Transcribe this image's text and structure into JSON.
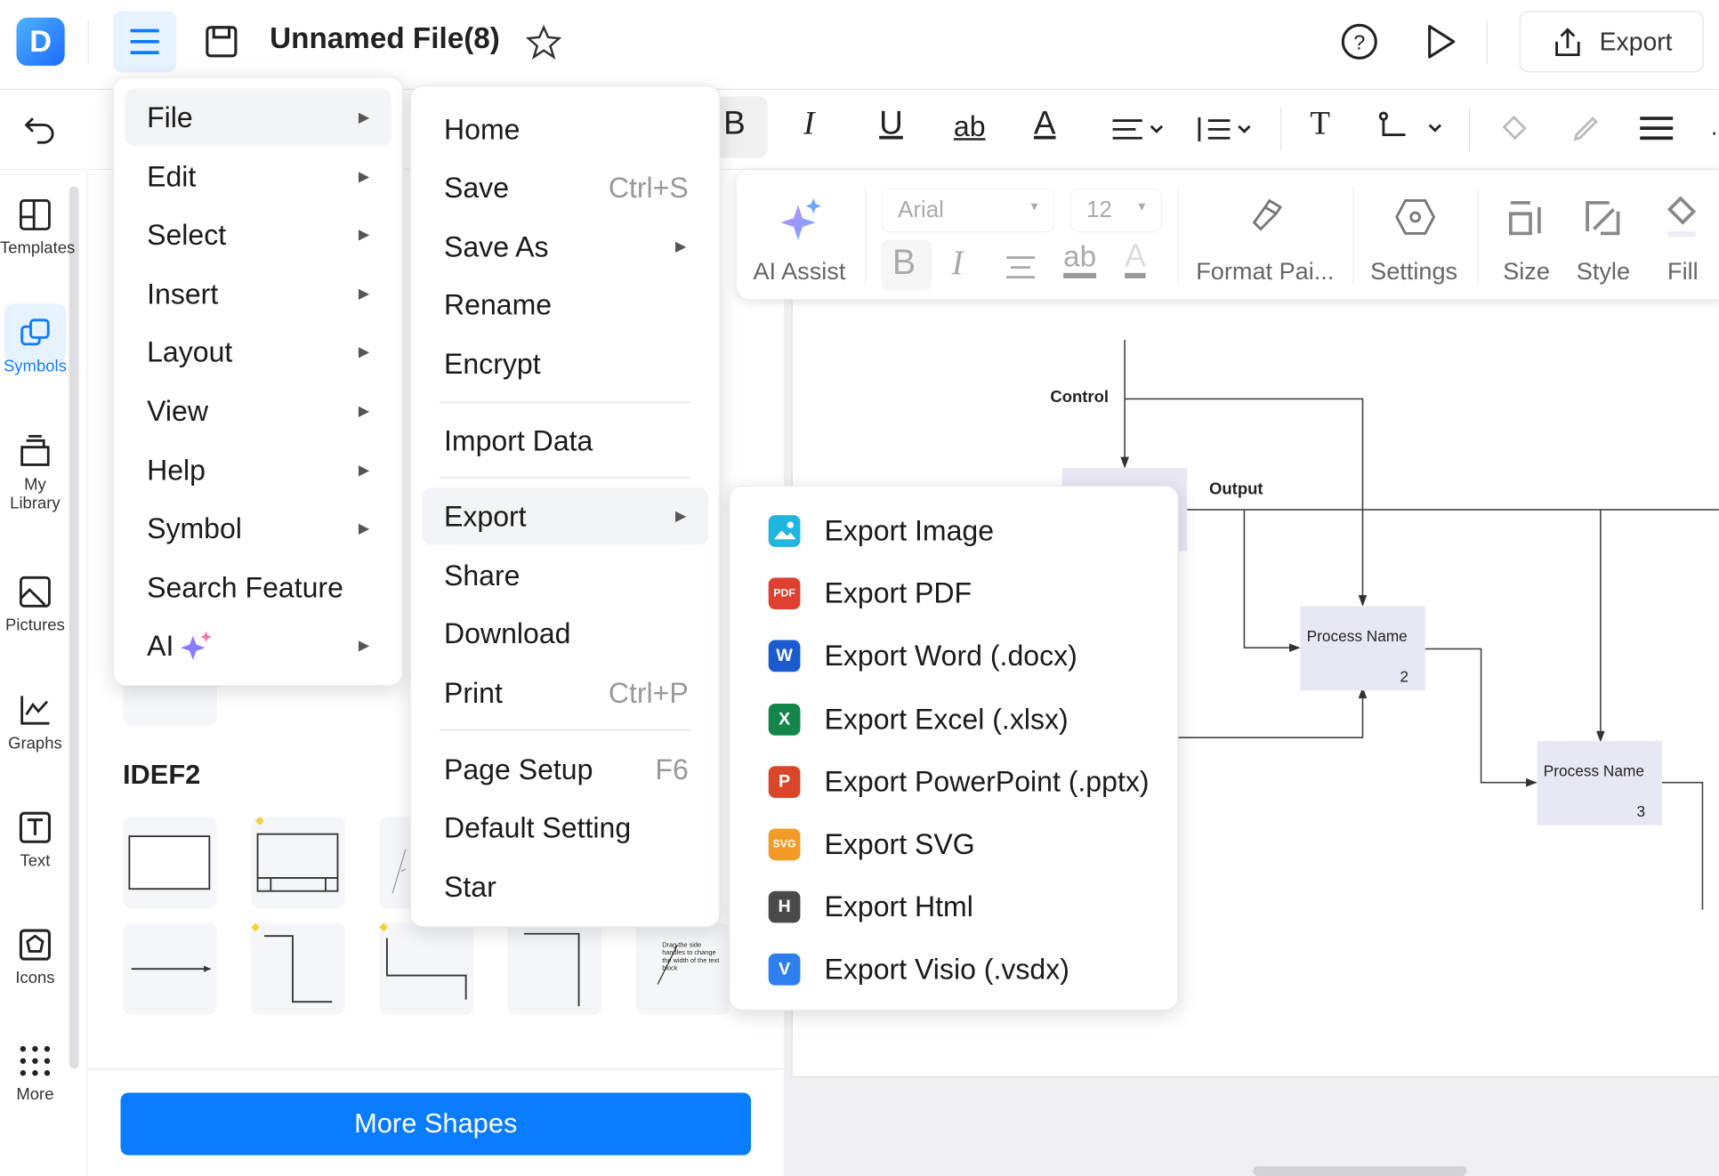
{
  "header": {
    "logo": "D",
    "title": "Unnamed File(8)",
    "export_label": "Export",
    "icons": [
      "menu-icon",
      "save-icon",
      "star-icon",
      "help-icon",
      "play-icon",
      "share-export-icon"
    ]
  },
  "toolbar": {
    "bold": "B",
    "italic": "I",
    "underline": "U",
    "strike": "ab",
    "font_color": "A",
    "text": "T"
  },
  "format_bar": {
    "ai_assist": "AI Assist",
    "font": "Arial",
    "size": "12",
    "format_painter": "Format Pai...",
    "settings": "Settings",
    "size_label": "Size",
    "style": "Style",
    "fill": "Fill",
    "bold": "B",
    "italic": "I",
    "strike": "ab",
    "color": "A"
  },
  "rail": [
    {
      "label": "Templates"
    },
    {
      "label": "Symbols",
      "active": true
    },
    {
      "label": "My Library"
    },
    {
      "label": "Pictures"
    },
    {
      "label": "Graphs"
    },
    {
      "label": "Text"
    },
    {
      "label": "Icons"
    },
    {
      "label": "More"
    }
  ],
  "panel": {
    "section": "IDEF2",
    "more_shapes": "More Shapes",
    "tile_note": "Drag the side handles to change the width of the text block"
  },
  "main_menu": [
    {
      "label": "File",
      "submenu": true,
      "active": true
    },
    {
      "label": "Edit",
      "submenu": true
    },
    {
      "label": "Select",
      "submenu": true
    },
    {
      "label": "Insert",
      "submenu": true
    },
    {
      "label": "Layout",
      "submenu": true
    },
    {
      "label": "View",
      "submenu": true
    },
    {
      "label": "Help",
      "submenu": true
    },
    {
      "label": "Symbol",
      "submenu": true
    },
    {
      "label": "Search Feature"
    },
    {
      "label": "AI",
      "submenu": true
    }
  ],
  "file_menu": {
    "home": "Home",
    "save": "Save",
    "save_sc": "Ctrl+S",
    "save_as": "Save As",
    "rename": "Rename",
    "encrypt": "Encrypt",
    "import": "Import Data",
    "export": "Export",
    "share": "Share",
    "download": "Download",
    "print": "Print",
    "print_sc": "Ctrl+P",
    "page_setup": "Page Setup",
    "page_setup_sc": "F6",
    "default": "Default Setting",
    "star": "Star"
  },
  "export_menu": [
    {
      "label": "Export Image",
      "badge": "",
      "color": "#1fb6e0"
    },
    {
      "label": "Export PDF",
      "badge": "PDF",
      "color": "#e0402f"
    },
    {
      "label": "Export Word (.docx)",
      "badge": "W",
      "color": "#1a5bd0"
    },
    {
      "label": "Export Excel (.xlsx)",
      "badge": "X",
      "color": "#14864a"
    },
    {
      "label": "Export PowerPoint (.pptx)",
      "badge": "P",
      "color": "#d9472b"
    },
    {
      "label": "Export SVG",
      "badge": "SVG",
      "color": "#f29b27"
    },
    {
      "label": "Export Html",
      "badge": "H",
      "color": "#4a4a4a"
    },
    {
      "label": "Export Visio (.vsdx)",
      "badge": "V",
      "color": "#2d7ff0"
    }
  ],
  "diagram": {
    "control": "Control",
    "output": "Output",
    "box2_name": "Process Name",
    "box2_num": "2",
    "box3_name": "Process Name",
    "box3_num": "3"
  },
  "colors": {
    "accent": "#0a7cff",
    "box_fill": "#e8e8f5"
  }
}
